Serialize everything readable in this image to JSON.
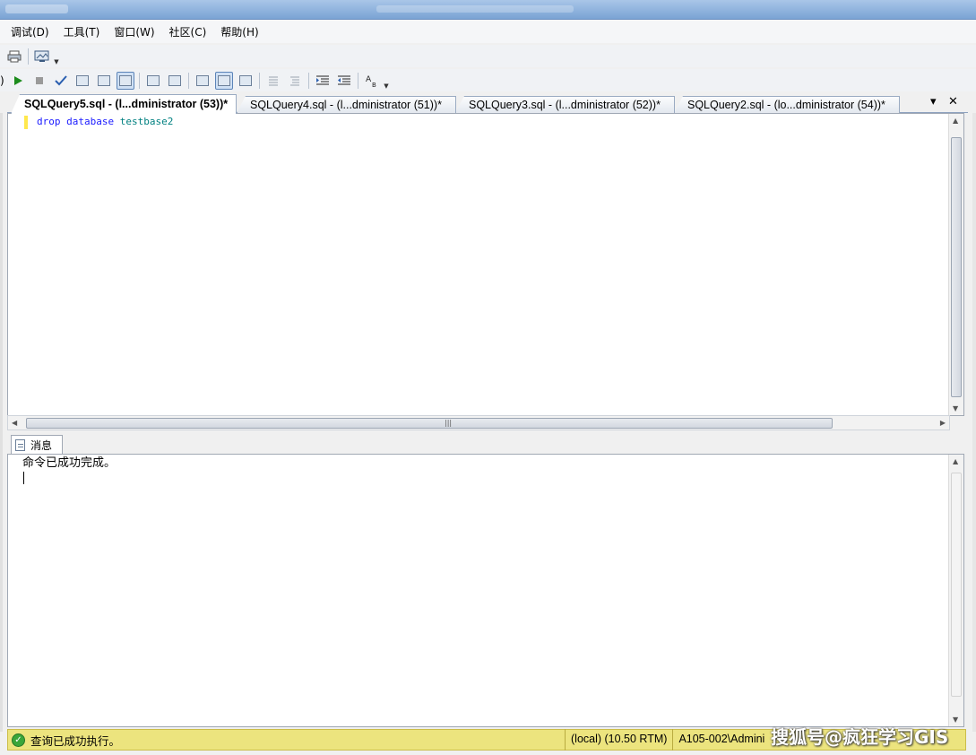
{
  "menu": [
    "调试(D)",
    "工具(T)",
    "窗口(W)",
    "社区(C)",
    "帮助(H)"
  ],
  "toolbar1": {
    "icons": [
      "print-icon",
      "screen-icon"
    ]
  },
  "toolbar2": {
    "left_glyph": ")",
    "icons": [
      "execute-icon",
      "stop-icon",
      "parse-check-icon",
      "query-design-icon",
      "results-text-icon",
      "results-grid-icon",
      "results-file-icon",
      "include-plan-icon",
      "client-stats-icon",
      "comment-icon",
      "uncomment-icon",
      "indent-icon",
      "outdent-icon",
      "specify-values-icon"
    ]
  },
  "tabs": [
    {
      "label": "SQLQuery5.sql - (l...dministrator (53))*",
      "active": true
    },
    {
      "label": "SQLQuery4.sql - (l...dministrator (51))*",
      "active": false
    },
    {
      "label": "SQLQuery3.sql - (l...dministrator (52))*",
      "active": false
    },
    {
      "label": "SQLQuery2.sql - (lo...dministrator (54))*",
      "active": false
    }
  ],
  "tab_controls": {
    "dropdown": "▾",
    "close": "✕"
  },
  "editor": {
    "kw1": "drop",
    "kw2": "database",
    "ident": "testbase2"
  },
  "results": {
    "tab_label": "消息",
    "message": "命令已成功完成。"
  },
  "status": {
    "text": "查询已成功执行。",
    "server": "(local) (10.50 RTM)",
    "login": "A105-002\\Admini"
  },
  "watermark": "搜狐号@疯狂学习GIS",
  "colors": {
    "status_bg": "#ece47e",
    "keyword": "#1a1aff",
    "identifier": "#008080",
    "modified_marker": "#ffe84d"
  }
}
